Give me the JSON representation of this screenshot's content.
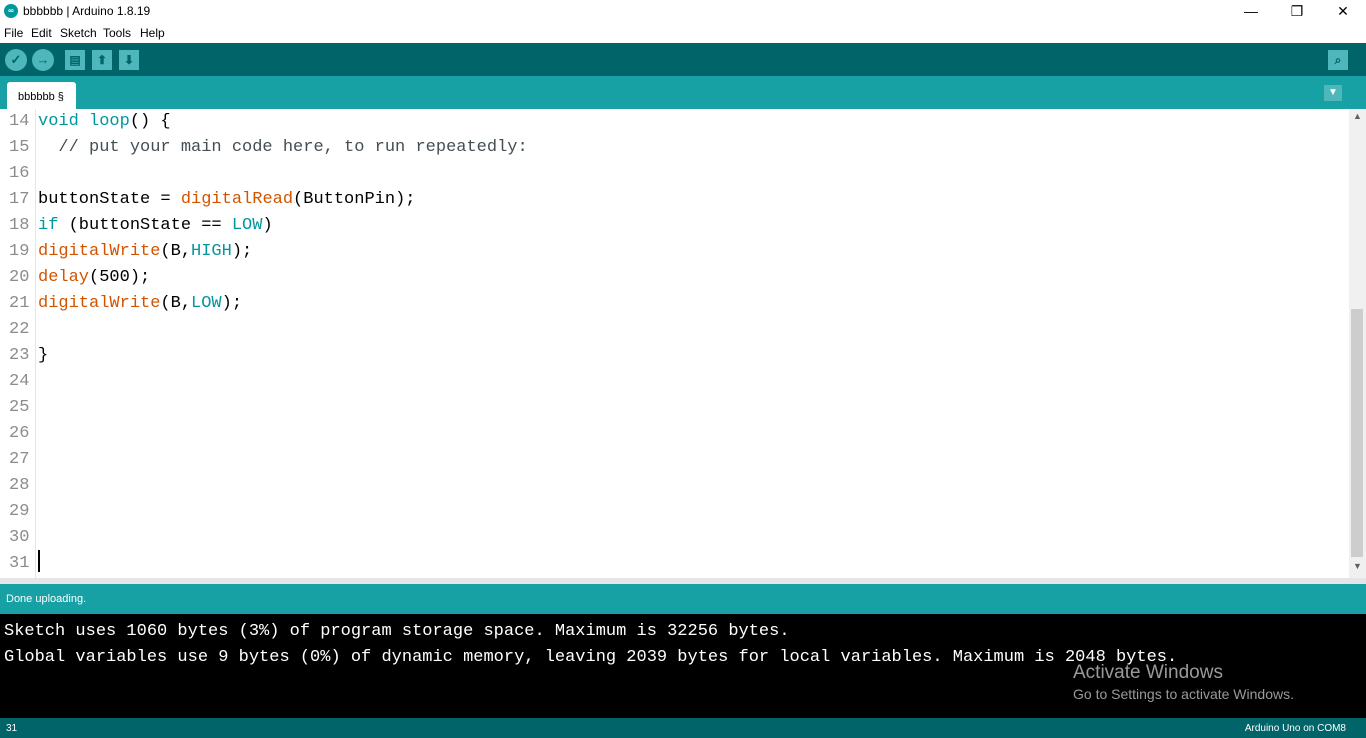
{
  "window": {
    "title": "bbbbbb | Arduino 1.8.19",
    "app_icon": "arduino-logo-icon",
    "minimize": "—",
    "restore": "❐",
    "close": "✕"
  },
  "menu": [
    "File",
    "Edit",
    "Sketch",
    "Tools",
    "Help"
  ],
  "toolbar": {
    "verify_icon": "✓",
    "upload_icon": "→",
    "new_icon": "▤",
    "open_icon": "⬆",
    "save_icon": "⬇",
    "serial_monitor_icon": "⌕"
  },
  "tabs": [
    {
      "label": "bbbbbb §"
    }
  ],
  "tab_menu_icon": "▼",
  "editor": {
    "lines": [
      {
        "num": "14",
        "tokens": [
          {
            "t": "void",
            "c": "kw"
          },
          {
            "t": " "
          },
          {
            "t": "loop",
            "c": "kw"
          },
          {
            "t": "() {"
          }
        ]
      },
      {
        "num": "15",
        "tokens": [
          {
            "t": "  // put your main code here, to run repeatedly:",
            "c": "cmt"
          }
        ]
      },
      {
        "num": "16",
        "tokens": []
      },
      {
        "num": "17",
        "tokens": [
          {
            "t": "buttonState = "
          },
          {
            "t": "digitalRead",
            "c": "fn"
          },
          {
            "t": "(ButtonPin);"
          }
        ]
      },
      {
        "num": "18",
        "tokens": [
          {
            "t": "if",
            "c": "kw"
          },
          {
            "t": " (buttonState == "
          },
          {
            "t": "LOW",
            "c": "kw"
          },
          {
            "t": ")"
          }
        ]
      },
      {
        "num": "19",
        "tokens": [
          {
            "t": "digitalWrite",
            "c": "fn"
          },
          {
            "t": "(B,"
          },
          {
            "t": "HIGH",
            "c": "kw"
          },
          {
            "t": ");"
          }
        ]
      },
      {
        "num": "20",
        "tokens": [
          {
            "t": "delay",
            "c": "fn"
          },
          {
            "t": "(500);"
          }
        ]
      },
      {
        "num": "21",
        "tokens": [
          {
            "t": "digitalWrite",
            "c": "fn"
          },
          {
            "t": "(B,"
          },
          {
            "t": "LOW",
            "c": "kw"
          },
          {
            "t": ");"
          }
        ]
      },
      {
        "num": "22",
        "tokens": []
      },
      {
        "num": "23",
        "tokens": [
          {
            "t": "}"
          }
        ]
      },
      {
        "num": "24",
        "tokens": []
      },
      {
        "num": "25",
        "tokens": []
      },
      {
        "num": "26",
        "tokens": []
      },
      {
        "num": "27",
        "tokens": []
      },
      {
        "num": "28",
        "tokens": []
      },
      {
        "num": "29",
        "tokens": []
      },
      {
        "num": "30",
        "tokens": []
      },
      {
        "num": "31",
        "tokens": []
      }
    ],
    "colors": {
      "keyword": "#00979d",
      "function": "#d35400",
      "comment": "#434f54"
    },
    "scroll_up_icon": "▲",
    "scroll_down_icon": "▼"
  },
  "status": {
    "message": "Done uploading."
  },
  "console": {
    "lines": [
      "Sketch uses 1060 bytes (3%) of program storage space. Maximum is 32256 bytes.",
      "Global variables use 9 bytes (0%) of dynamic memory, leaving 2039 bytes for local variables. Maximum is 2048 bytes."
    ]
  },
  "watermark": {
    "title": "Activate Windows",
    "subtitle": "Go to Settings to activate Windows."
  },
  "bottom": {
    "line_number": "31",
    "board": "Arduino Uno on COM8"
  }
}
